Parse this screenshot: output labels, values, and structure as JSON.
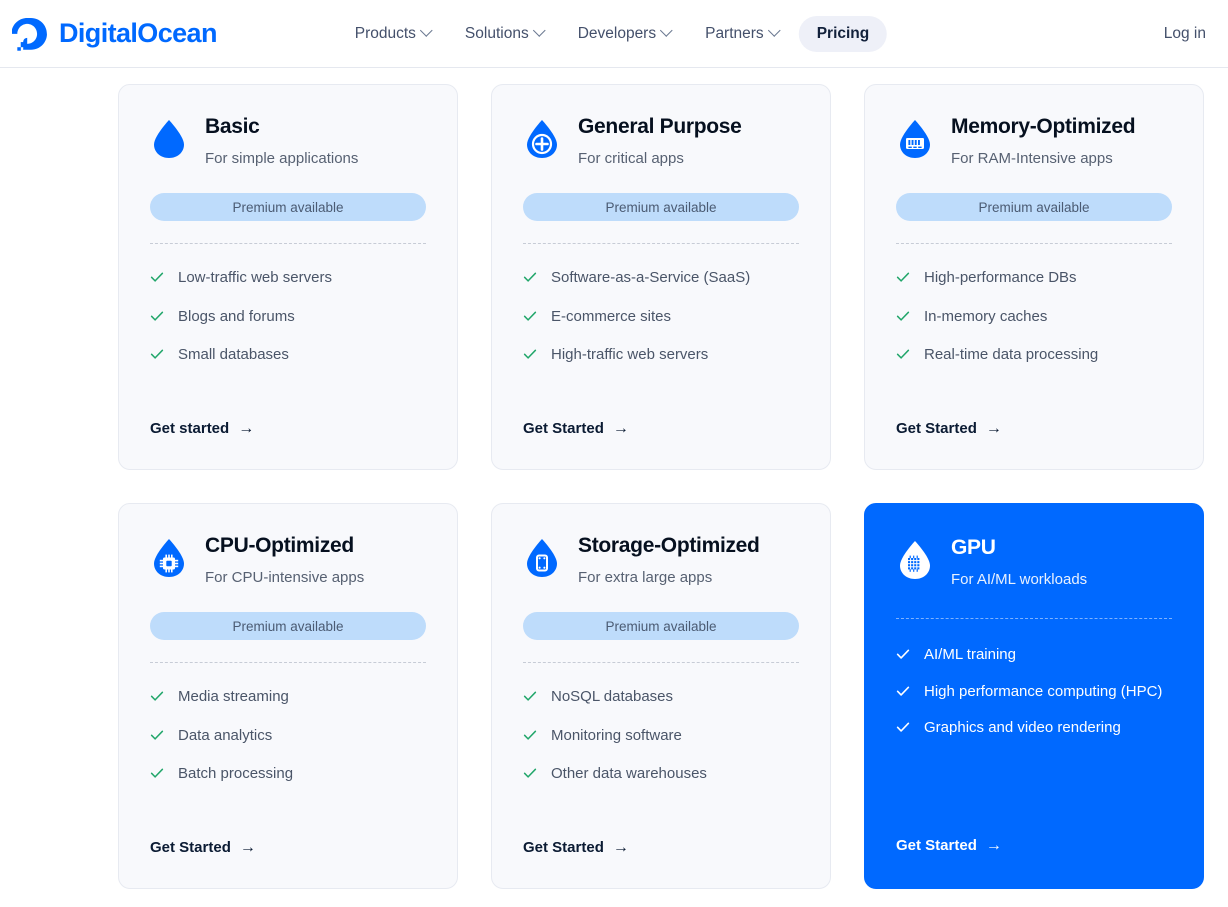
{
  "header": {
    "brand": "DigitalOcean",
    "brand_color": "#0069ff",
    "nav": [
      {
        "label": "Products",
        "has_chevron": true,
        "active": false
      },
      {
        "label": "Solutions",
        "has_chevron": true,
        "active": false
      },
      {
        "label": "Developers",
        "has_chevron": true,
        "active": false
      },
      {
        "label": "Partners",
        "has_chevron": true,
        "active": false
      },
      {
        "label": "Pricing",
        "has_chevron": false,
        "active": true
      }
    ],
    "login_label": "Log in"
  },
  "cards": [
    {
      "title": "Basic",
      "subtitle": "For simple applications",
      "icon": "droplet-plain-icon",
      "badge": "Premium available",
      "features": [
        "Low-traffic web servers",
        "Blogs and forums",
        "Small databases"
      ],
      "cta": "Get started",
      "cta_arrow": "→",
      "featured": false
    },
    {
      "title": "General Purpose",
      "subtitle": "For critical apps",
      "icon": "droplet-plus-icon",
      "badge": "Premium available",
      "features": [
        "Software-as-a-Service (SaaS)",
        "E-commerce sites",
        "High-traffic web servers"
      ],
      "cta": "Get Started",
      "cta_arrow": "→",
      "featured": false
    },
    {
      "title": "Memory-Optimized",
      "subtitle": "For RAM-Intensive apps",
      "icon": "droplet-memory-icon",
      "badge": "Premium available",
      "features": [
        "High-performance DBs",
        "In-memory caches",
        "Real-time data processing"
      ],
      "cta": "Get Started",
      "cta_arrow": "→",
      "featured": false
    },
    {
      "title": "CPU-Optimized",
      "subtitle": "For CPU-intensive apps",
      "icon": "droplet-cpu-icon",
      "badge": "Premium available",
      "features": [
        "Media streaming",
        "Data analytics",
        "Batch processing"
      ],
      "cta": "Get Started",
      "cta_arrow": "→",
      "featured": false
    },
    {
      "title": "Storage-Optimized",
      "subtitle": "For extra large apps",
      "icon": "droplet-storage-icon",
      "badge": "Premium available",
      "features": [
        "NoSQL databases",
        "Monitoring software",
        "Other data warehouses"
      ],
      "cta": "Get Started",
      "cta_arrow": "→",
      "featured": false
    },
    {
      "title": "GPU",
      "subtitle": "For AI/ML workloads",
      "icon": "droplet-gpu-icon",
      "badge": null,
      "features": [
        "AI/ML training",
        "High performance computing (HPC)",
        "Graphics and video rendering"
      ],
      "cta": "Get Started",
      "cta_arrow": "→",
      "featured": true
    }
  ],
  "colors": {
    "brand_blue": "#0069ff",
    "card_bg": "#f8f9fc",
    "pill_bg": "#bedcfb",
    "check_green": "#21a66a",
    "featured_bg": "#0069ff"
  }
}
